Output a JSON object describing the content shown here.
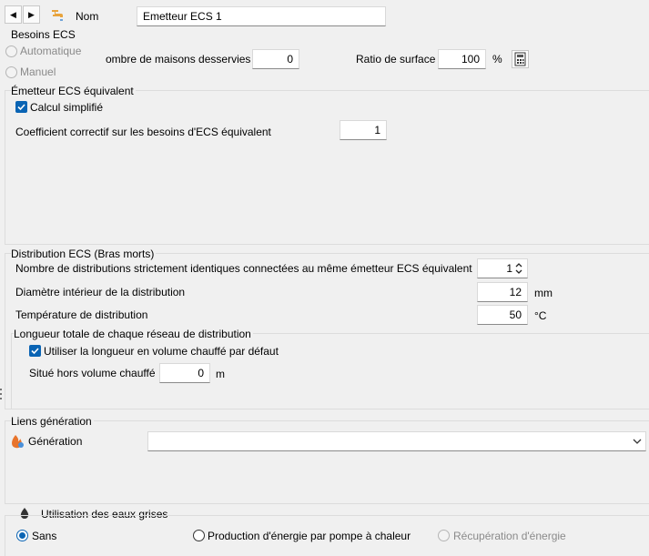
{
  "header": {
    "nom_label": "Nom",
    "nom_value": "Emetteur ECS 1"
  },
  "besoins": {
    "title": "Besoins ECS",
    "mode_auto": "Automatique",
    "mode_manuel": "Manuel",
    "nb_maisons_label": "ombre de maisons desservies",
    "nb_maisons_value": "0",
    "ratio_label": "Ratio de surface",
    "ratio_value": "100",
    "ratio_unit": "%"
  },
  "emetteur": {
    "title": "Émetteur ECS équivalent",
    "calcul_simplifie": "Calcul simplifié",
    "coef_label": "Coefficient correctif sur les besoins d'ECS équivalent",
    "coef_value": "1"
  },
  "distribution": {
    "title": "Distribution ECS (Bras morts)",
    "nb_distrib_label": "Nombre de distributions strictement identiques connectées au même émetteur ECS équivalent",
    "nb_distrib_value": "1",
    "diametre_label": "Diamètre intérieur de la distribution",
    "diametre_value": "12",
    "diametre_unit": "mm",
    "temp_label": "Température de distribution",
    "temp_value": "50",
    "temp_unit": "°C"
  },
  "longueur": {
    "title": "Longueur totale de chaque réseau de distribution",
    "utiliser_label": "Utiliser la longueur en volume chauffé par défaut",
    "hors_volume_label": "Situé hors volume chauffé",
    "hors_volume_value": "0",
    "hors_volume_unit": "m"
  },
  "liens": {
    "title": "Liens génération",
    "generation_label": "Génération",
    "generation_value": ""
  },
  "eaux_grises": {
    "title": "Utilisation des eaux grises",
    "opt_sans": "Sans",
    "opt_pompe": "Production d'énergie par pompe à chaleur",
    "opt_recup": "Récupération d'énergie"
  },
  "colors": {
    "accent": "#0a64b4",
    "disabled_text": "#8a8a8a",
    "faucet_icon": "#e8a33c",
    "flame_icon": "#e8742c",
    "drop_icon": "#333333"
  }
}
